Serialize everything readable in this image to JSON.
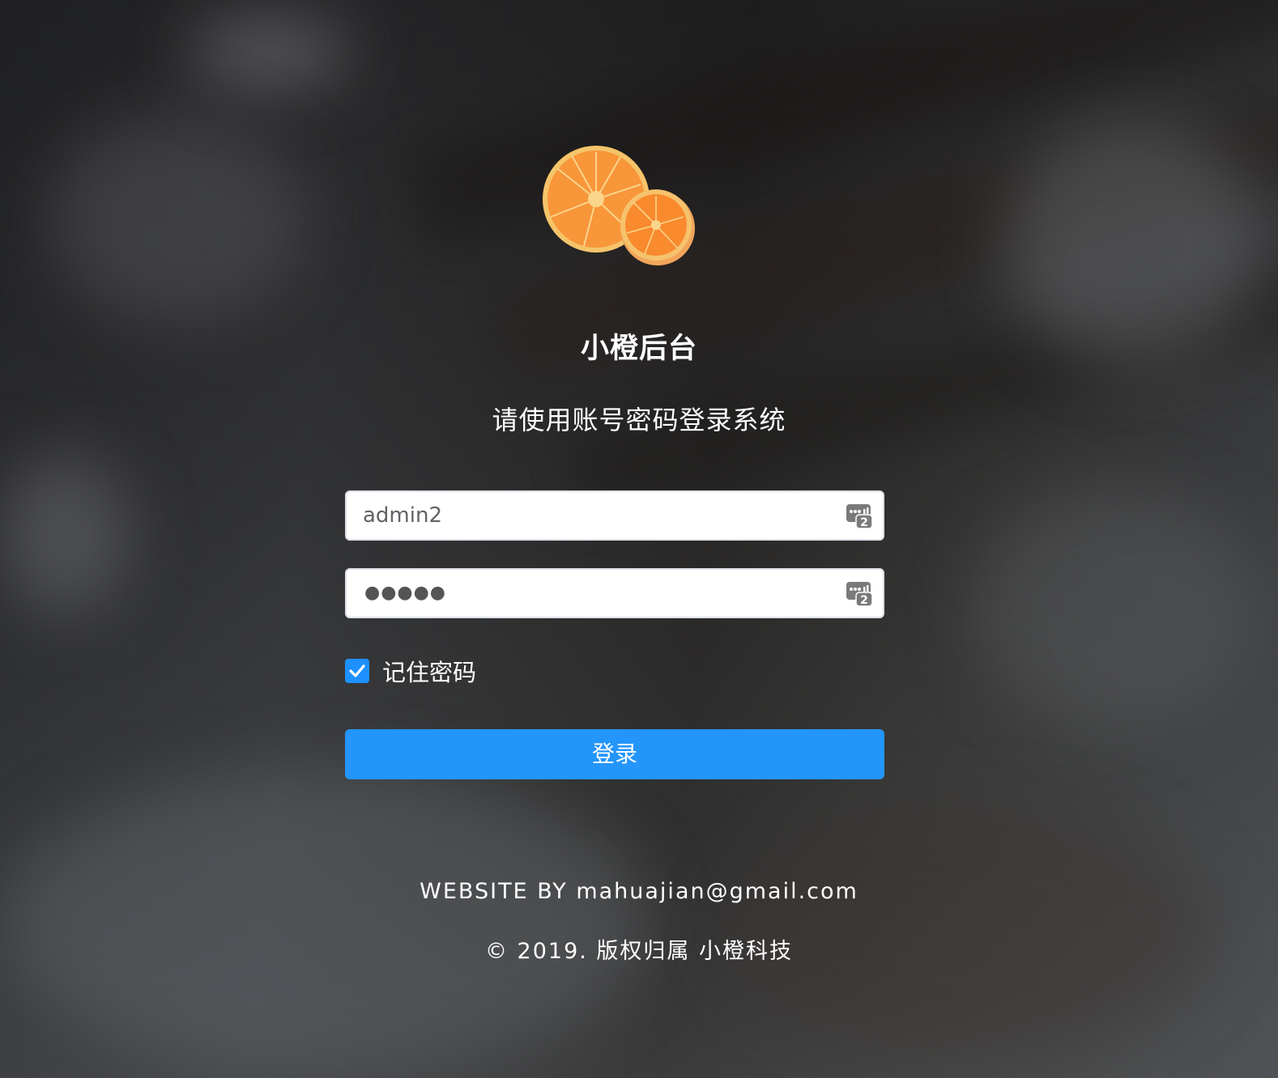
{
  "brand": {
    "title": "小橙后台",
    "subtitle": "请使用账号密码登录系统",
    "logo_icon": "orange-logo-icon"
  },
  "login_form": {
    "username_value": "admin2",
    "password_masked": "●●●●●",
    "password_icon": "password-manager-icon",
    "username_icon": "password-manager-icon",
    "remember_label": "记住密码",
    "remember_checked": true,
    "submit_label": "登录"
  },
  "footer": {
    "credit": "WEBSITE BY mahuajian@gmail.com",
    "copyright": "© 2019. 版权归属 小橙科技"
  },
  "colors": {
    "accent": "#2395fb",
    "checkbox": "#1e90ff",
    "orange": "#f58a2a"
  }
}
